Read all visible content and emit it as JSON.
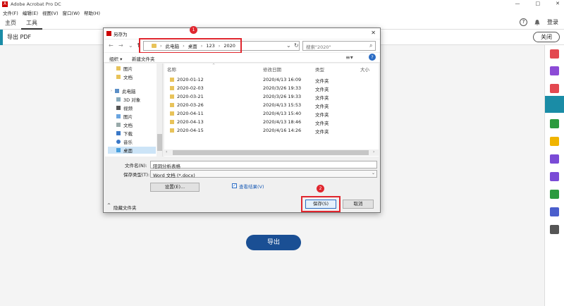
{
  "app": {
    "title": "Adobe Acrobat Pro DC",
    "window_controls": [
      "—",
      "□",
      "✕"
    ]
  },
  "menu": [
    "文件(F)",
    "编辑(E)",
    "视图(V)",
    "窗口(W)",
    "帮助(H)"
  ],
  "tabs": [
    "主页",
    "工具"
  ],
  "header_right": {
    "help": "?",
    "login": "登录"
  },
  "toolbar": {
    "label": "导出 PDF",
    "close_label": "关闭"
  },
  "export_button": "导出",
  "dialog": {
    "title": "另存为",
    "breadcrumbs": [
      "此电脑",
      "桌面",
      "123",
      "2020"
    ],
    "search_placeholder": "搜索\"2020\"",
    "organize": "组织 ▾",
    "new_folder": "新建文件夹",
    "nav_items": [
      "图片",
      "文档",
      "此电脑",
      "3D 对象",
      "视频",
      "图片",
      "文档",
      "下载",
      "音乐",
      "桌面"
    ],
    "columns": [
      "名称",
      "修改日期",
      "类型",
      "大小"
    ],
    "files": [
      {
        "name": "2020-01-12",
        "date": "2020/4/13 16:09",
        "type": "文件夹"
      },
      {
        "name": "2020-02-03",
        "date": "2020/3/26 19:33",
        "type": "文件夹"
      },
      {
        "name": "2020-03-21",
        "date": "2020/3/26 19:33",
        "type": "文件夹"
      },
      {
        "name": "2020-03-26",
        "date": "2020/4/13 15:53",
        "type": "文件夹"
      },
      {
        "name": "2020-04-11",
        "date": "2020/4/13 15:40",
        "type": "文件夹"
      },
      {
        "name": "2020-04-13",
        "date": "2020/4/13 18:46",
        "type": "文件夹"
      },
      {
        "name": "2020-04-15",
        "date": "2020/4/16 14:26",
        "type": "文件夹"
      }
    ],
    "filename_label": "文件名(N):",
    "filename_value": "阳洞分析表格",
    "filetype_label": "保存类型(T):",
    "filetype_value": "Word 文档 (*.docx)",
    "settings_button": "设置(E)...",
    "view_result_label": "查看结果(V)",
    "hide_folders": "隐藏文件夹",
    "save_button": "保存(S)",
    "cancel_button": "取消",
    "badge_1": "1",
    "badge_2": "2"
  },
  "colors": {
    "accent": "#1a8ca6",
    "export_button": "#1a4f94",
    "highlight_red": "#e0262e",
    "folder": "#e8c35a"
  }
}
